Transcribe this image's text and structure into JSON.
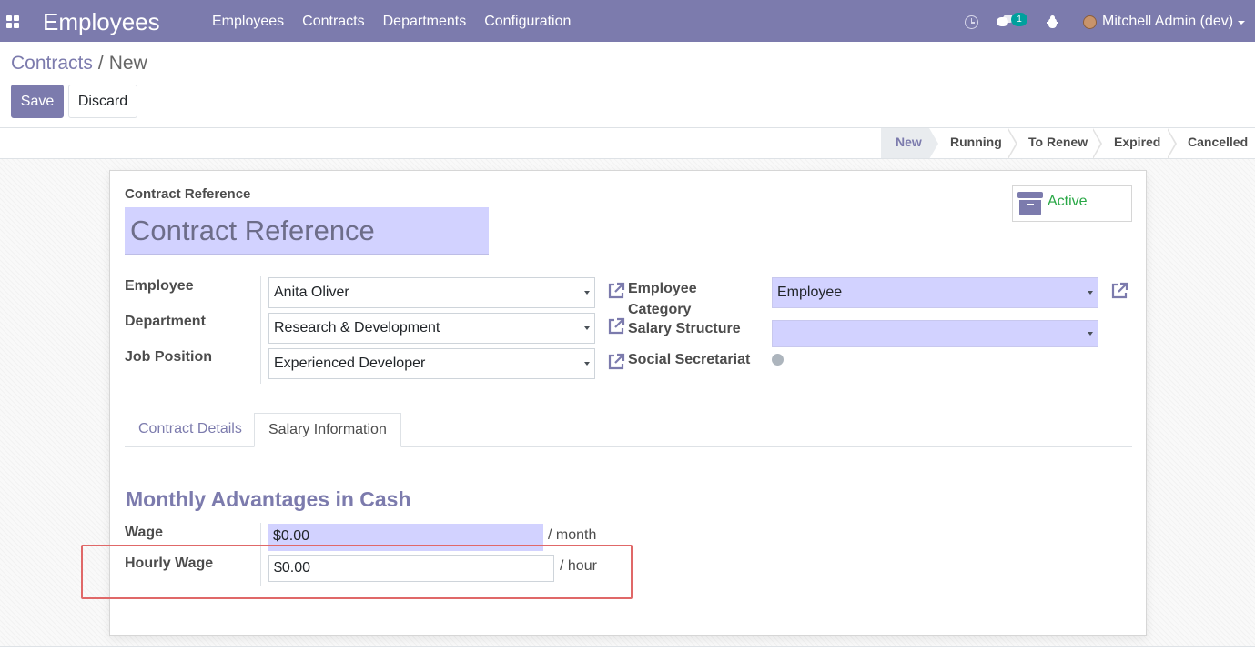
{
  "navbar": {
    "brand": "Employees",
    "menu": [
      "Employees",
      "Contracts",
      "Departments",
      "Configuration"
    ],
    "chat_count": "1",
    "user": "Mitchell Admin (dev)"
  },
  "breadcrumb": {
    "parent": "Contracts",
    "separator": "/",
    "current": "New"
  },
  "buttons": {
    "save": "Save",
    "discard": "Discard"
  },
  "stages": [
    "New",
    "Running",
    "To Renew",
    "Expired",
    "Cancelled"
  ],
  "active_stage": "New",
  "form": {
    "reference_label": "Contract Reference",
    "reference_placeholder": "Contract Reference",
    "active_label": "Active",
    "employee_label": "Employee",
    "employee_value": "Anita Oliver",
    "department_label": "Department",
    "department_value": "Research & Development",
    "job_label": "Job Position",
    "job_value": "Experienced Developer",
    "employee_category_label": "Employee Category",
    "employee_category_value": "Employee",
    "salary_structure_label": "Salary Structure",
    "salary_structure_value": "",
    "social_secretariat_label": "Social Secretariat"
  },
  "tabs": [
    "Contract Details",
    "Salary Information"
  ],
  "active_tab": "Salary Information",
  "salary": {
    "section_title": "Monthly Advantages in Cash",
    "wage_label": "Wage",
    "wage_value": "$0.00",
    "wage_unit": "/ month",
    "hourly_label": "Hourly Wage",
    "hourly_value": "$0.00",
    "hourly_unit": "/ hour"
  },
  "colors": {
    "brand": "#7c7bad",
    "required_field": "#d2d2ff",
    "active_green": "#28a745",
    "highlight": "#e06868",
    "badge": "#00a09d"
  }
}
